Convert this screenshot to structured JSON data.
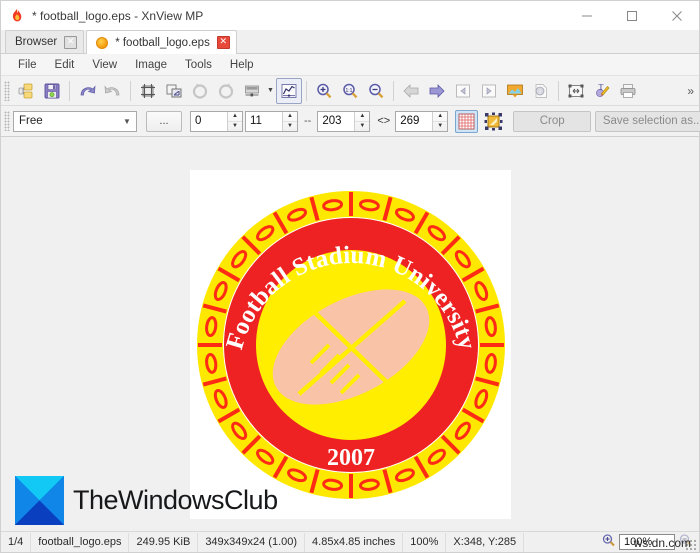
{
  "window": {
    "title": "* football_logo.eps - XnView MP",
    "app_icon": "xnview-flame-icon",
    "minimize_label": "—",
    "maximize_label": "▢",
    "close_label": "✕"
  },
  "tabs": [
    {
      "label": "Browser",
      "close_label": "✕",
      "active": false,
      "has_dot": false
    },
    {
      "label": "* football_logo.eps",
      "close_label": "✕",
      "active": true,
      "has_dot": true
    }
  ],
  "menu": {
    "items": [
      "File",
      "Edit",
      "View",
      "Image",
      "Tools",
      "Help"
    ]
  },
  "toolbar": {
    "overflow_label": "»",
    "buttons": [
      {
        "name": "open-folder-icon",
        "tip": "Open"
      },
      {
        "name": "save-icon",
        "tip": "Save"
      },
      {
        "name": "undo-icon",
        "tip": "Undo"
      },
      {
        "name": "redo-icon",
        "tip": "Redo"
      },
      {
        "name": "crop-icon",
        "tip": "Crop"
      },
      {
        "name": "resize-icon",
        "tip": "Resize"
      },
      {
        "name": "rotate-left-icon",
        "tip": "Rotate left"
      },
      {
        "name": "rotate-right-icon",
        "tip": "Rotate right"
      },
      {
        "name": "adjust-icon",
        "tip": "Adjust"
      },
      {
        "name": "curves-icon",
        "tip": "Curves"
      },
      {
        "name": "zoom-in-icon",
        "tip": "Zoom in"
      },
      {
        "name": "zoom-actual-icon",
        "tip": "Actual size 1:1"
      },
      {
        "name": "zoom-out-icon",
        "tip": "Zoom out"
      },
      {
        "name": "previous-icon",
        "tip": "Previous"
      },
      {
        "name": "next-icon",
        "tip": "Next"
      },
      {
        "name": "first-page-icon",
        "tip": "First"
      },
      {
        "name": "last-page-icon",
        "tip": "Last"
      },
      {
        "name": "slideshow-icon",
        "tip": "Slideshow"
      },
      {
        "name": "info-icon",
        "tip": "Information"
      },
      {
        "name": "fullscreen-icon",
        "tip": "Full screen"
      },
      {
        "name": "draw-text-icon",
        "tip": "Draw / Text"
      },
      {
        "name": "print-icon",
        "tip": "Print"
      }
    ]
  },
  "selection_bar": {
    "shape_mode": "Free",
    "shape_chevron": "⌄",
    "ellipsis_label": "...",
    "x_value": "0",
    "y_value": "11",
    "dash_label": "--",
    "width_value": "203",
    "link_label": "<>",
    "height_value": "269",
    "grid_icon": "grid-icon",
    "center_icon": "center-selection-icon",
    "crop_label": "Crop",
    "save_selection_label": "Save selection as...",
    "overflow_label": "»",
    "spinner_up": "▲",
    "spinner_down": "▼"
  },
  "image": {
    "logo": {
      "arc_text": "Football Stadium University",
      "year_text": "2007",
      "colors": {
        "ring_red": "#ee2222",
        "chain_yellow": "#ffe800",
        "center_yellow": "#ffee00",
        "ball_peach": "#f9c3a8",
        "text_white": "#ffffff"
      }
    }
  },
  "watermark": {
    "brand": "TheWindowsClub",
    "logo_name": "thewindowsclub-logo",
    "small_text": "ws.dn.com"
  },
  "statusbar": {
    "page_count": "1/4",
    "filename": "football_logo.eps",
    "filesize": "249.95 KiB",
    "dimensions": "349x349x24 (1.00)",
    "print_size": "4.85x4.85 inches",
    "zoom_percent": "100%",
    "cursor": "X:348, Y:285",
    "zoom_field_value": "100%",
    "zoom_out_icon": "zoom-out-icon",
    "zoom_in_icon": "zoom-in-icon"
  }
}
